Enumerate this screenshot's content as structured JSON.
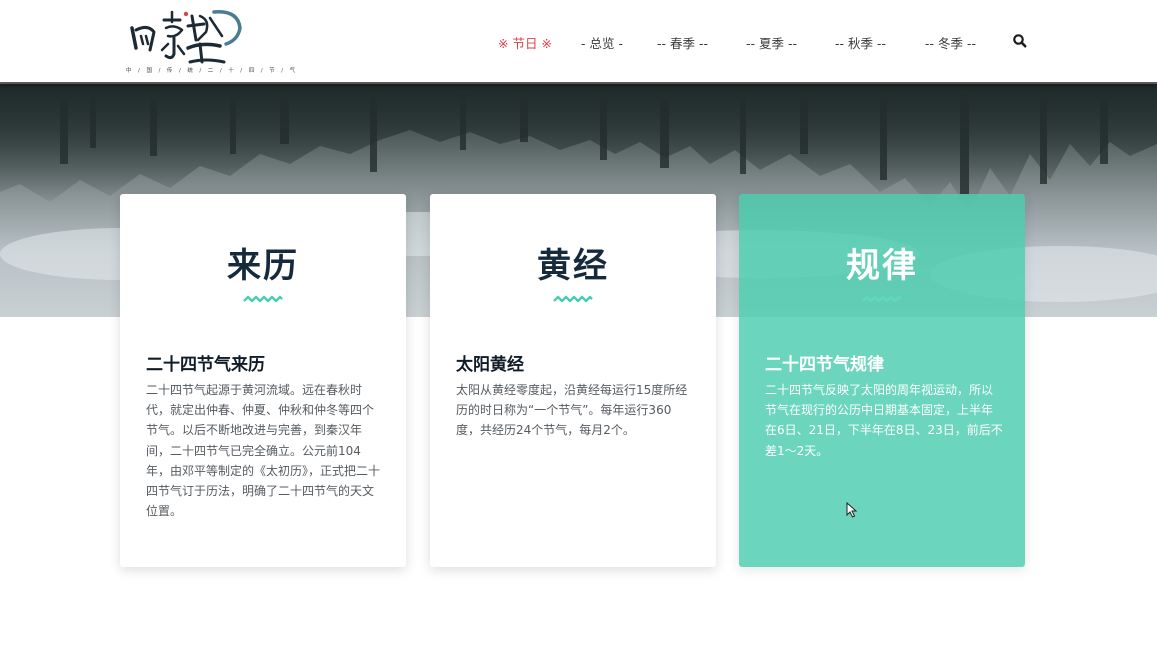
{
  "logo": {
    "subtitle": "中 / 国 / 传 / 统 / 二 / 十 / 四 / 节 / 气"
  },
  "nav": {
    "items": [
      {
        "label": "※ 节日 ※",
        "active": true
      },
      {
        "label": "- 总览 -",
        "active": false
      },
      {
        "label": "-- 春季 --",
        "active": false
      },
      {
        "label": "-- 夏季 --",
        "active": false
      },
      {
        "label": "-- 秋季 --",
        "active": false
      },
      {
        "label": "-- 冬季 --",
        "active": false
      }
    ],
    "search_icon": "search-icon"
  },
  "cards": [
    {
      "title": "来历",
      "subtitle": "二十四节气来历",
      "text": "二十四节气起源于黄河流域。远在春秋时代，就定出仲春、仲夏、仲秋和仲冬等四个节气。以后不断地改进与完善，到秦汉年间，二十四节气已完全确立。公元前104年，由邓平等制定的《太初历》，正式把二十四节气订于历法，明确了二十四节气的天文位置。"
    },
    {
      "title": "黄经",
      "subtitle": "太阳黄经",
      "text": "太阳从黄经零度起，沿黄经每运行15度所经历的时日称为“一个节气”。每年运行360度，共经历24个节气，每月2个。"
    },
    {
      "title": "规律",
      "subtitle": "二十四节气规律",
      "text": "二十四节气反映了太阳的周年视运动，所以节气在现行的公历中日期基本固定，上半年在6日、21日，下半年在8日、23日，前后不差1～2天。"
    }
  ],
  "colors": {
    "accent_red": "#d9414a",
    "accent_teal": "#4acdaf",
    "title_dark": "#152a3c"
  }
}
